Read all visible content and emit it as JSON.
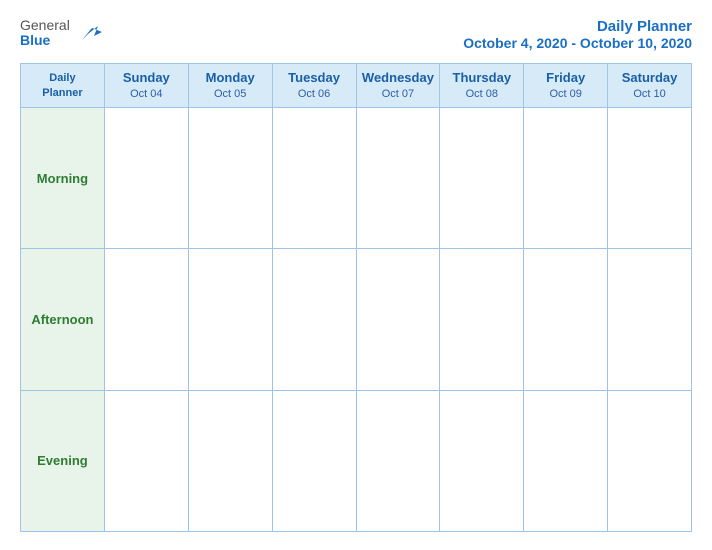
{
  "header": {
    "logo": {
      "general": "General",
      "blue": "Blue"
    },
    "app_title": "Daily Planner",
    "date_range": "October 4, 2020 - October 10, 2020"
  },
  "table": {
    "header_label_line1": "Daily",
    "header_label_line2": "Planner",
    "columns": [
      {
        "day": "Sunday",
        "date": "Oct 04"
      },
      {
        "day": "Monday",
        "date": "Oct 05"
      },
      {
        "day": "Tuesday",
        "date": "Oct 06"
      },
      {
        "day": "Wednesday",
        "date": "Oct 07"
      },
      {
        "day": "Thursday",
        "date": "Oct 08"
      },
      {
        "day": "Friday",
        "date": "Oct 09"
      },
      {
        "day": "Saturday",
        "date": "Oct 10"
      }
    ],
    "rows": [
      {
        "label": "Morning"
      },
      {
        "label": "Afternoon"
      },
      {
        "label": "Evening"
      }
    ]
  }
}
